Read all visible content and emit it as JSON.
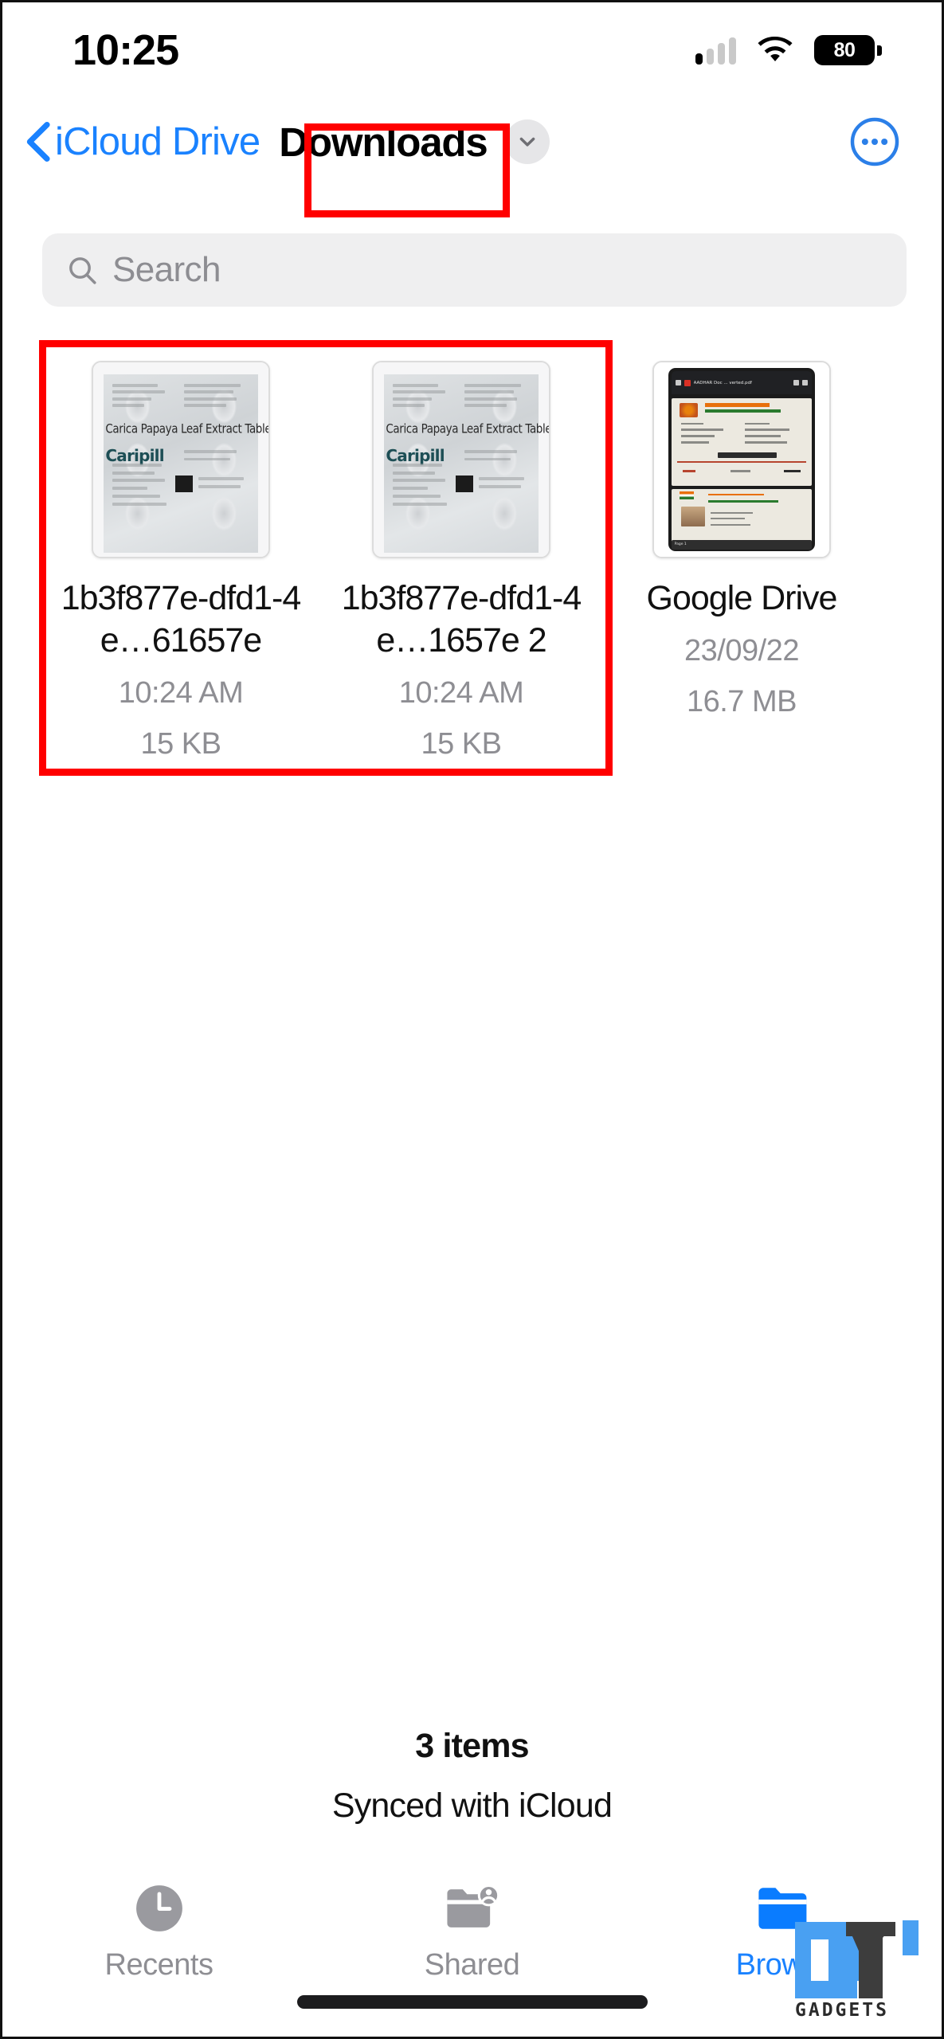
{
  "status_bar": {
    "time": "10:25",
    "cellular_icon": "cellular-signal-icon",
    "wifi_icon": "wifi-icon",
    "battery_level": "80",
    "battery_icon": "battery-icon"
  },
  "nav": {
    "back_icon": "chevron-left-icon",
    "back_label": "iCloud Drive",
    "title": "Downloads",
    "title_chevron_icon": "chevron-down-icon",
    "more_icon": "ellipsis-circle-icon"
  },
  "search": {
    "icon": "search-icon",
    "placeholder": "Search",
    "value": ""
  },
  "files": [
    {
      "name": "1b3f877e-dfd1-4e…61657e",
      "date": "10:24 AM",
      "size": "15 KB",
      "thumbnail": "pill-blister-pack-thumbnail",
      "thumb_text_main": "Carica Papaya Leaf Extract Tablets",
      "thumb_text_brand": "Caripill"
    },
    {
      "name": "1b3f877e-dfd1-4e…1657e 2",
      "date": "10:24 AM",
      "size": "15 KB",
      "thumbnail": "pill-blister-pack-thumbnail",
      "thumb_text_main": "Carica Papaya Leaf Extract Tablets",
      "thumb_text_brand": "Caripill"
    },
    {
      "name": "Google Drive",
      "date": "23/09/22",
      "size": "16.7 MB",
      "thumbnail": "pdf-screenshot-thumbnail",
      "thumb_topbar_title": "AADHAR Doc ... verted.pdf",
      "thumb_page_label": "Page 1"
    }
  ],
  "footer": {
    "item_count": "3 items",
    "sync_status": "Synced with iCloud"
  },
  "tabs": [
    {
      "label": "Recents",
      "icon": "clock-icon",
      "active": false
    },
    {
      "label": "Shared",
      "icon": "shared-folder-icon",
      "active": false
    },
    {
      "label": "Browse",
      "icon": "folder-icon",
      "active": true
    }
  ],
  "watermark": {
    "text": "GADGETS",
    "logo": "gt-logo-icon"
  },
  "colors": {
    "accent": "#1a82ff",
    "highlight": "#ff0000",
    "muted": "#8e8e93",
    "search_bg": "#efeff0"
  }
}
